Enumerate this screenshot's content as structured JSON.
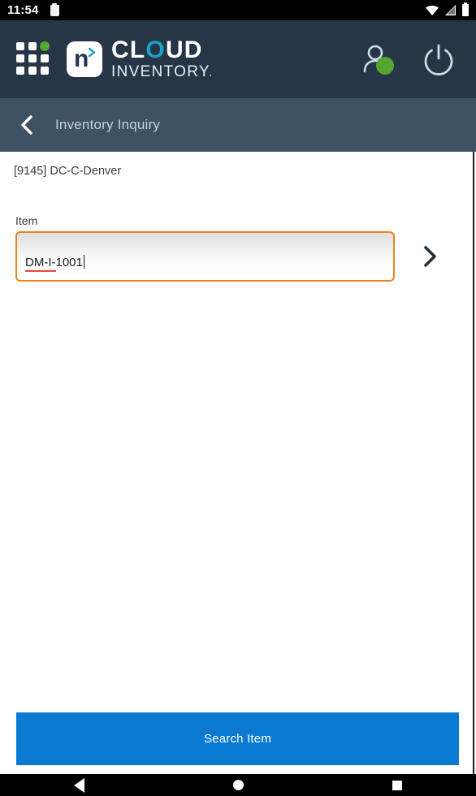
{
  "status_bar": {
    "time": "11:54",
    "left_icon": "clipboard-icon",
    "right_icons": [
      "wifi-icon",
      "cellular-signal-icon",
      "battery-icon"
    ]
  },
  "header": {
    "menu_icon": "grid-menu-icon",
    "logo_letter": "n",
    "brand_line1_a": "CL",
    "brand_line1_o": "O",
    "brand_line1_b": "UD",
    "brand_line2": "INVENTORY",
    "brand_line2_dot": ".",
    "profile_icon": "user-profile-icon",
    "profile_status": "online",
    "power_icon": "power-logout-icon",
    "accent_teal": "#1b9fc4",
    "accent_green": "#55a630",
    "background": "#263646"
  },
  "subheader": {
    "back_icon": "back-chevron-icon",
    "title": "Inventory Inquiry",
    "background": "#3e5263"
  },
  "main": {
    "location": "[9145] DC-C-Denver",
    "item_field": {
      "label": "Item",
      "value": "DM-I-1001",
      "placeholder": "",
      "border_color": "#e8841a",
      "spellcheck_marked": "DM-I"
    },
    "next_icon": "chevron-right-icon"
  },
  "footer": {
    "search_button_label": "Search Item",
    "search_button_color": "#0a7ad2"
  },
  "navbar": {
    "back": "nav-back-icon",
    "home": "nav-home-icon",
    "recents": "nav-recents-icon"
  }
}
